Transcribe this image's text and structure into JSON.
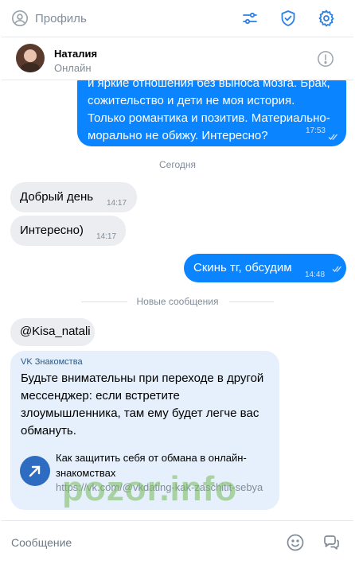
{
  "topbar": {
    "profile_label": "Профиль",
    "icons": [
      "user-circle-icon",
      "filter-sliders-icon",
      "shield-check-icon",
      "gear-icon"
    ]
  },
  "chat_header": {
    "name": "Наталия",
    "status": "Онлайн",
    "icons": [
      "avatar",
      "info-icon"
    ]
  },
  "messages": [
    {
      "direction": "outgoing",
      "text": "и яркие отношения без выноса мозга. Брак, сожительство и дети не моя история. Только романтика и позитив. Материально-морально не обижу. Интересно?",
      "time": "17:53",
      "read": true
    },
    {
      "direction": "incoming",
      "text": "Добрый день",
      "time": "14:17"
    },
    {
      "direction": "incoming",
      "text": "Интересно)",
      "time": "14:17"
    },
    {
      "direction": "outgoing",
      "text": "Скинь тг, обсудим",
      "time": "14:48",
      "read": true
    },
    {
      "direction": "incoming",
      "text": "@Kisa_natali"
    }
  ],
  "separators": {
    "day": "Сегодня",
    "new_messages": "Новые сообщения"
  },
  "warning_card": {
    "source": "VK Знакомства",
    "text": "Будьте внимательны при переходе в другой мессенджер: если встретите злоумышленника, там ему будет легче вас обмануть.",
    "link_title": "Как защитить себя от обмана в онлайн-знакомствах",
    "link_url": "https://vk.com/@vkdating-kak-zaschitit-sebya"
  },
  "watermark": "pozor.info",
  "composer": {
    "placeholder": "Сообщение",
    "icons": [
      "emoji-icon",
      "voice-message-icon"
    ]
  },
  "colors": {
    "outgoing_bubble": "#0a84ff",
    "incoming_bubble": "#ebedf0",
    "card_bg": "#e5f0fc",
    "muted_text": "#818c99"
  }
}
